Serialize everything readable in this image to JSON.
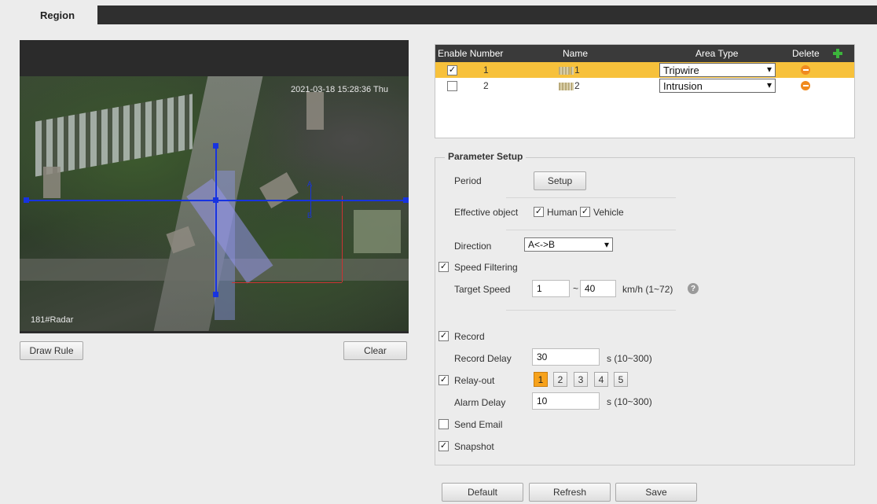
{
  "tab": {
    "label": "Region"
  },
  "video": {
    "timestamp": "2021-03-18 15:28:36 Thu",
    "camera_label": "181#Radar"
  },
  "video_buttons": {
    "draw_rule": "Draw Rule",
    "clear": "Clear"
  },
  "rules_table": {
    "headers": {
      "enable_number": "Enable Number",
      "name": "Name",
      "area_type": "Area Type",
      "delete": "Delete"
    },
    "rows": [
      {
        "enabled": true,
        "number": "1",
        "name_suffix": "1",
        "area_type": "Tripwire",
        "selected": true
      },
      {
        "enabled": false,
        "number": "2",
        "name_suffix": "2",
        "area_type": "Intrusion",
        "selected": false
      }
    ]
  },
  "params": {
    "title": "Parameter Setup",
    "period_label": "Period",
    "setup_button": "Setup",
    "effective_object_label": "Effective object",
    "human_label": "Human",
    "human_checked": true,
    "vehicle_label": "Vehicle",
    "vehicle_checked": true,
    "direction_label": "Direction",
    "direction_value": "A<->B",
    "speed_filtering_label": "Speed Filtering",
    "speed_filtering_checked": true,
    "target_speed_label": "Target Speed",
    "speed_min": "1",
    "speed_sep": "~",
    "speed_max": "40",
    "speed_unit": "km/h (1~72)",
    "help_icon": "?",
    "record_label": "Record",
    "record_checked": true,
    "record_delay_label": "Record Delay",
    "record_delay_value": "30",
    "record_delay_unit": "s (10~300)",
    "relay_out_label": "Relay-out",
    "relay_out_checked": true,
    "relay_channels": [
      "1",
      "2",
      "3",
      "4",
      "5"
    ],
    "relay_active": "1",
    "alarm_delay_label": "Alarm Delay",
    "alarm_delay_value": "10",
    "alarm_delay_unit": "s (10~300)",
    "send_email_label": "Send Email",
    "send_email_checked": false,
    "snapshot_label": "Snapshot",
    "snapshot_checked": true
  },
  "footer": {
    "default": "Default",
    "refresh": "Refresh",
    "save": "Save"
  },
  "colors": {
    "accent": "#f7c13b",
    "rule_line": "#1733e0",
    "header_bg": "#3a3a3a"
  }
}
